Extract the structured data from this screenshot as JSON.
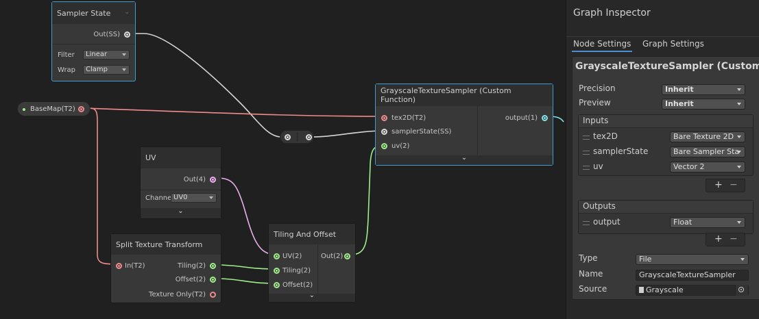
{
  "colors": {
    "texture2d": "#f28b8b",
    "sampler": "#dddddd",
    "vector2": "#9ff08a",
    "vector4": "#f0b0f0",
    "float": "#84e4e7",
    "selection": "#3d9ed6"
  },
  "sampler_state": {
    "title": "Sampler State",
    "out_port": "Out(SS)",
    "filter_label": "Filter",
    "filter_value": "Linear",
    "wrap_label": "Wrap",
    "wrap_value": "Clamp"
  },
  "basemap": {
    "label": "BaseMap(T2)"
  },
  "uv_node": {
    "title": "UV",
    "out_port": "Out(4)",
    "channel_label": "Channe",
    "channel_value": "UV0",
    "expand_icon": "chevron-down-icon"
  },
  "split_node": {
    "title": "Split Texture Transform",
    "in_port": "In(T2)",
    "outputs": [
      "Tiling(2)",
      "Offset(2)",
      "Texture Only(T2)"
    ]
  },
  "tiling_node": {
    "title": "Tiling And Offset",
    "inputs": [
      "UV(2)",
      "Tiling(2)",
      "Offset(2)"
    ],
    "out_port": "Out(2)"
  },
  "custom_node": {
    "title": "GrayscaleTextureSampler (Custom Function)",
    "inputs": [
      "tex2D(T2)",
      "samplerState(SS)",
      "uv(2)"
    ],
    "out_port": "output(1)"
  },
  "inspector": {
    "title": "Graph Inspector",
    "tabs": [
      "Node Settings",
      "Graph Settings"
    ],
    "active_tab": "Node Settings",
    "heading": "GrayscaleTextureSampler (Custom F",
    "precision_label": "Precision",
    "precision_value": "Inherit",
    "preview_label": "Preview",
    "preview_value": "Inherit",
    "inputs_header": "Inputs",
    "inputs": [
      {
        "name": "tex2D",
        "type": "Bare Texture 2D"
      },
      {
        "name": "samplerState",
        "type": "Bare Sampler Sta"
      },
      {
        "name": "uv",
        "type": "Vector 2"
      }
    ],
    "outputs_header": "Outputs",
    "outputs": [
      {
        "name": "output",
        "type": "Float"
      }
    ],
    "add_symbol": "+",
    "remove_symbol": "−",
    "type_label": "Type",
    "type_value": "File",
    "name_label": "Name",
    "name_value": "GrayscaleTextureSampler",
    "source_label": "Source",
    "source_value": "Grayscale"
  }
}
